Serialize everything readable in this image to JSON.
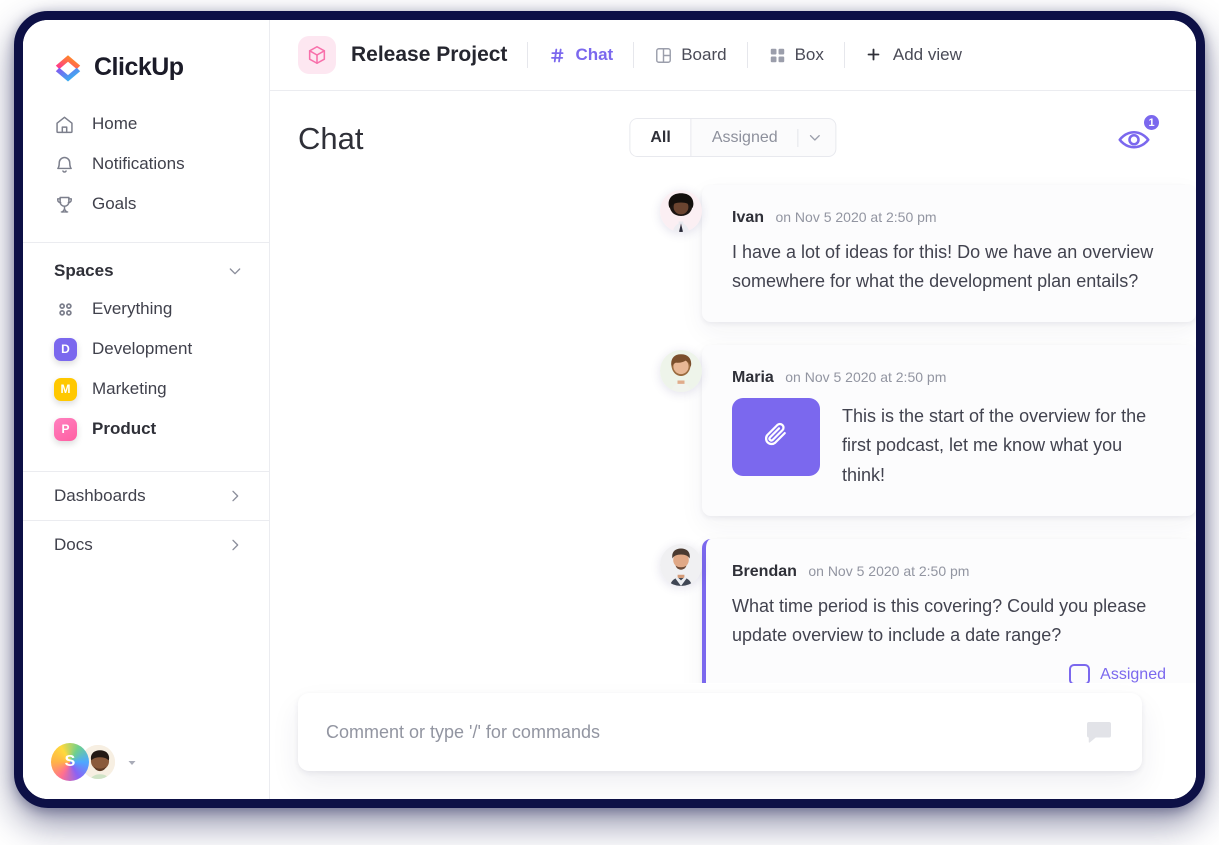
{
  "brand": {
    "name": "ClickUp"
  },
  "sidebar": {
    "nav": [
      {
        "label": "Home",
        "icon": "home-icon"
      },
      {
        "label": "Notifications",
        "icon": "bell-icon"
      },
      {
        "label": "Goals",
        "icon": "trophy-icon"
      }
    ],
    "spaces_section": {
      "title": "Spaces",
      "chevron": "chevron-down-icon"
    },
    "spaces": [
      {
        "label": "Everything",
        "badge": "",
        "color": "",
        "icon": "grid-dots-icon",
        "active": false
      },
      {
        "label": "Development",
        "badge": "D",
        "color": "#7b68ee",
        "active": false
      },
      {
        "label": "Marketing",
        "badge": "M",
        "color": "#ffc800",
        "active": false
      },
      {
        "label": "Product",
        "badge": "P",
        "color": "#ff6cab",
        "active": true
      }
    ],
    "footer_items": [
      {
        "label": "Dashboards",
        "icon": "chevron-right-icon"
      },
      {
        "label": "Docs",
        "icon": "chevron-right-icon"
      }
    ],
    "user": {
      "initial": "S",
      "caret": "caret-down-icon"
    }
  },
  "topbar": {
    "project_icon": "cube-icon",
    "project_name": "Release Project",
    "views": [
      {
        "label": "Chat",
        "icon": "hash-icon",
        "active": true
      },
      {
        "label": "Board",
        "icon": "board-icon",
        "active": false
      },
      {
        "label": "Box",
        "icon": "box-grid-icon",
        "active": false
      }
    ],
    "add_view": {
      "label": "Add view",
      "icon": "plus-icon"
    }
  },
  "page": {
    "title": "Chat",
    "filter": {
      "options": [
        "All",
        "Assigned"
      ],
      "selected": "All",
      "caret": "chevron-down-icon"
    },
    "watchers": {
      "icon": "eye-icon",
      "count": "1"
    }
  },
  "messages": [
    {
      "author": "Ivan",
      "time": "on Nov 5 2020 at 2:50 pm",
      "text": "I have a lot of ideas for this! Do we have an overview somewhere for what the development plan entails?",
      "attachment": false,
      "assigned": false
    },
    {
      "author": "Maria",
      "time": "on Nov 5 2020 at 2:50 pm",
      "text": "This is the start of the overview for the first podcast, let me know what you think!",
      "attachment": true,
      "attachment_icon": "paperclip-icon",
      "assigned": false
    },
    {
      "author": "Brendan",
      "time": "on Nov 5 2020 at 2:50 pm",
      "text": "What time period is this covering? Could you please update overview to include a date range?",
      "attachment": false,
      "assigned": true,
      "assigned_label": "Assigned"
    }
  ],
  "composer": {
    "placeholder": "Comment or type '/' for commands",
    "value": "",
    "icon": "chat-bubble-icon"
  },
  "colors": {
    "accent_purple": "#7b68ee",
    "frame_navy": "#0d1046",
    "pink": "#ff6cab",
    "yellow": "#ffc800"
  }
}
